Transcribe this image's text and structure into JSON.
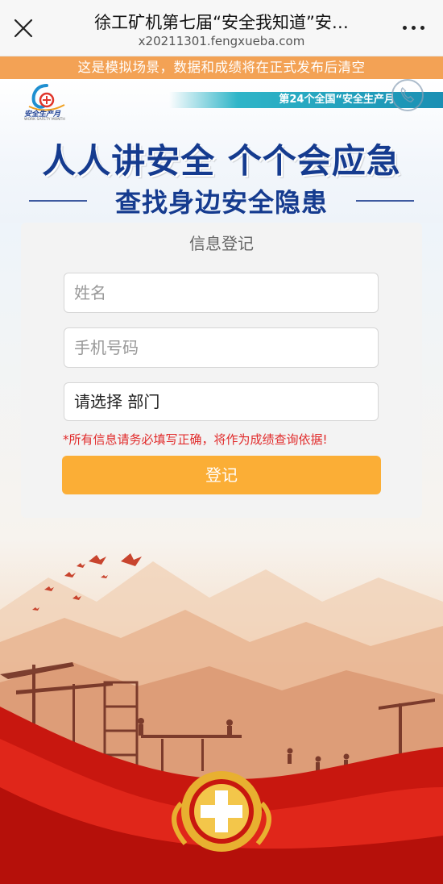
{
  "topbar": {
    "title": "徐工矿机第七届“安全我知道”安…",
    "url": "x20211301.fengxueba.com"
  },
  "notice": {
    "text": "这是模拟场景，数据和成绩将在正式发布后清空",
    "background": "#f3a255"
  },
  "banner": {
    "logo_text": "安全生产月",
    "logo_subtext": "WORK SAFETY MONTH",
    "ribbon_text": "第24个全国“安全生产月",
    "slogan_main": "人人讲安全  个个会应急",
    "slogan_sub": "查找身边安全隐患",
    "slogan_color": "#153b8f"
  },
  "form": {
    "title": "信息登记",
    "name_placeholder": "姓名",
    "phone_placeholder": "手机号码",
    "department_value": "请选择 部门",
    "warning": "*所有信息请务必填写正确，将作为成绩查询依据!",
    "warning_color": "#e12b2b",
    "submit_label": "登记",
    "submit_color": "#fbae36"
  },
  "icons": {
    "close": "close-icon",
    "more": "more-icon",
    "emblem": "safety-emblem-icon",
    "phone": "phone-icon"
  }
}
